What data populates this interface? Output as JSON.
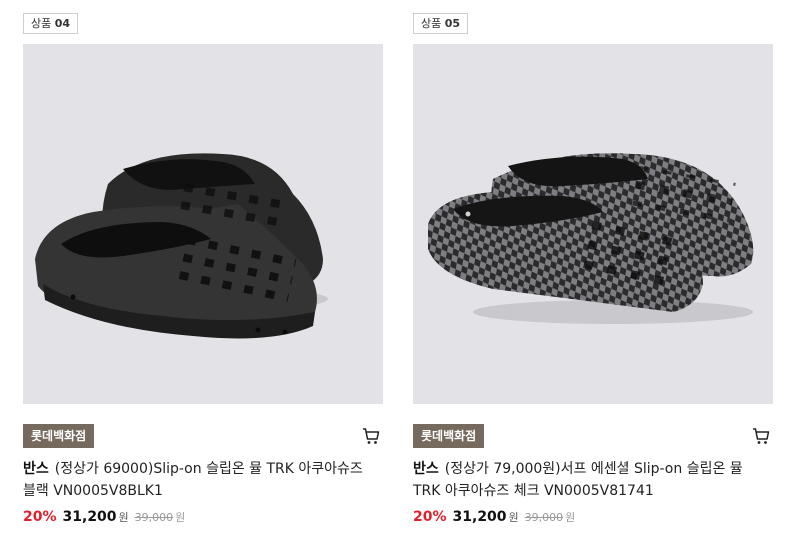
{
  "products": [
    {
      "tag_prefix": "상품",
      "tag_number": "04",
      "store": "롯데백화점",
      "brand": "반스",
      "name": "(정상가 69000)Slip-on 슬립온 뮬 TRK 아쿠아슈즈 블랙 VN0005V8BLK1",
      "discount": "20%",
      "sale_price": "31,200",
      "currency": "원",
      "original_price": "39,000",
      "image_icon": "black-slip-on-mule-image"
    },
    {
      "tag_prefix": "상품",
      "tag_number": "05",
      "store": "롯데백화점",
      "brand": "반스",
      "name": "(정상가 79,000원)서프 에센셜 Slip-on 슬립온 뮬 TRK 아쿠아슈즈 체크 VN0005V81741",
      "discount": "20%",
      "sale_price": "31,200",
      "currency": "원",
      "original_price": "39,000",
      "image_icon": "checkered-slip-on-mule-image"
    }
  ],
  "colors": {
    "store_badge": "#766a5e",
    "discount": "#e0202a",
    "image_bg": "#e3e2e6"
  }
}
